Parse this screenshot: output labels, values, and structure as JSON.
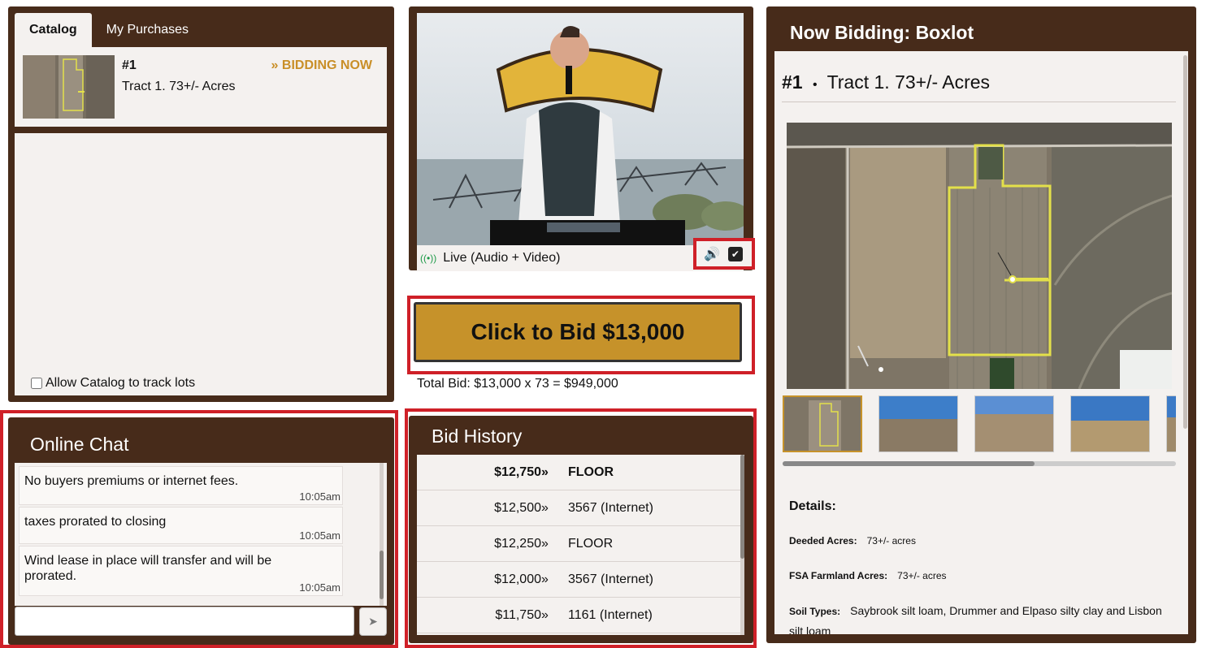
{
  "catalog": {
    "tabs": [
      {
        "label": "Catalog"
      },
      {
        "label": "My Purchases"
      }
    ],
    "lot": {
      "number": "#1",
      "title": "Tract 1. 73+/- Acres",
      "status": "» BIDDING NOW"
    },
    "track_label": "Allow Catalog to track lots"
  },
  "video": {
    "stream_label": "Live (Audio + Video)",
    "live_icon": "broadcast-icon",
    "volume_icon": "speaker-icon",
    "toggle_icon": "checkbox-icon"
  },
  "bid": {
    "button_label": "Click to Bid $13,000",
    "total": "Total Bid: $13,000 x 73 = $949,000"
  },
  "chat": {
    "title": "Online Chat",
    "messages": [
      {
        "text": "No buyers premiums or internet fees.",
        "time": "10:05am"
      },
      {
        "text": "taxes prorated to closing",
        "time": "10:05am"
      },
      {
        "text": "Wind lease in place will transfer and will be prorated.",
        "time": "10:05am"
      }
    ],
    "input_value": "",
    "send_icon": "send-arrow-icon"
  },
  "history": {
    "title": "Bid History",
    "rows": [
      {
        "amount": "$12,750",
        "arrow": "»",
        "bidder": "FLOOR"
      },
      {
        "amount": "$12,500",
        "arrow": "»",
        "bidder": "3567 (Internet)"
      },
      {
        "amount": "$12,250",
        "arrow": "»",
        "bidder": "FLOOR"
      },
      {
        "amount": "$12,000",
        "arrow": "»",
        "bidder": "3567 (Internet)"
      },
      {
        "amount": "$11,750",
        "arrow": "»",
        "bidder": "1161 (Internet)"
      }
    ]
  },
  "now": {
    "title": "Now Bidding: Boxlot",
    "lot_number": "#1",
    "lot_sep": "•",
    "lot_title": "Tract 1. 73+/- Acres",
    "details_heading": "Details:",
    "details": [
      {
        "key": "Deeded Acres:",
        "value": "73+/- acres"
      },
      {
        "key": "FSA Farmland Acres:",
        "value": "73+/- acres"
      },
      {
        "key": "Soil Types:",
        "value": "Saybrook silt loam, Drummer and Elpaso silty clay and Lisbon silt loam"
      }
    ]
  },
  "colors": {
    "brown": "#472b1a",
    "gold": "#c6922a",
    "status_gold": "#c98f28",
    "highlight_red": "#cf2028",
    "live_green": "#1d9a47"
  }
}
